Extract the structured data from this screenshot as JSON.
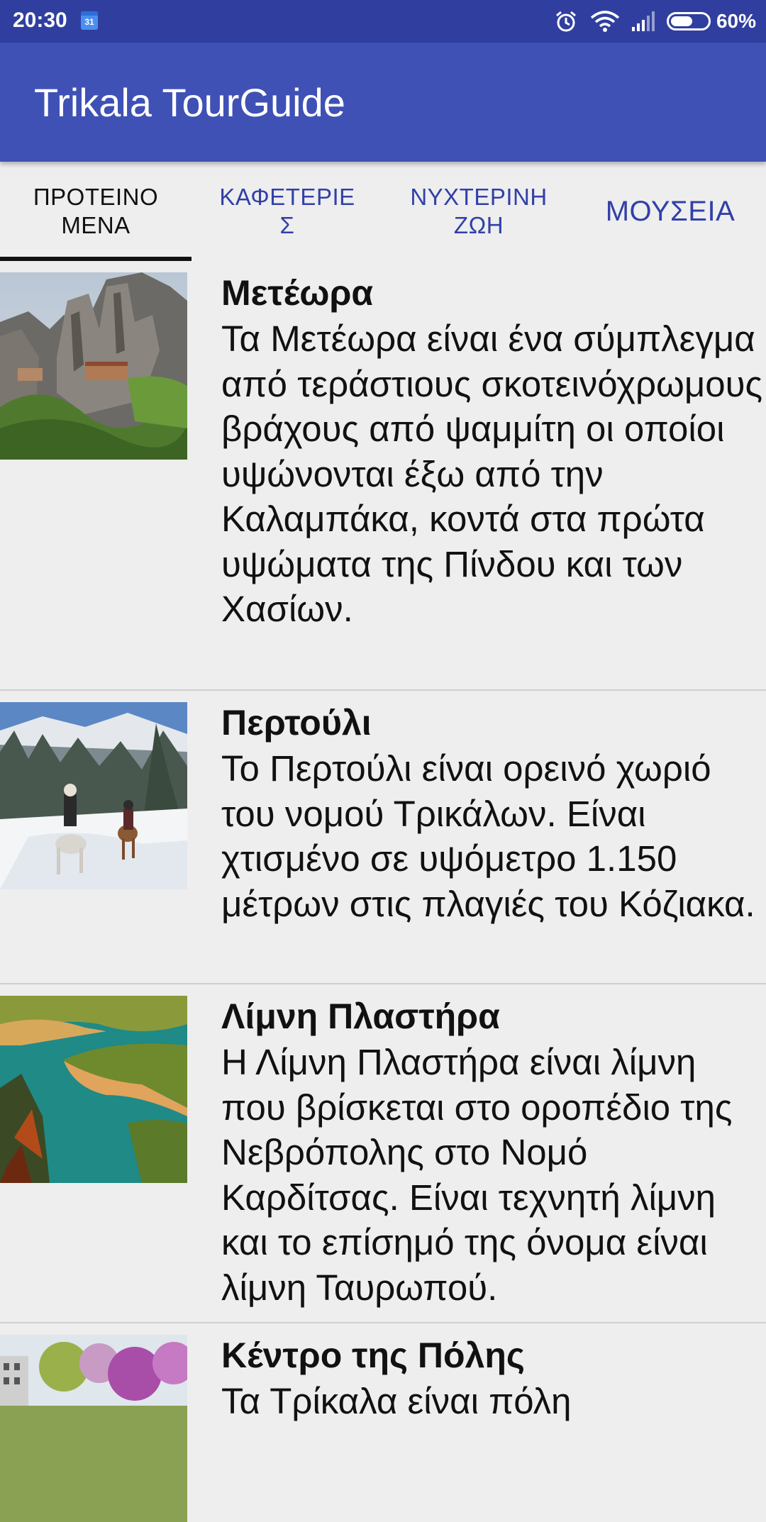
{
  "status_bar": {
    "time": "20:30",
    "calendar_day": "31",
    "battery_percent": "60%",
    "battery_level": 0.6,
    "icons": [
      "calendar-icon",
      "alarm-icon",
      "wifi-icon",
      "signal-icon",
      "battery-icon"
    ]
  },
  "app_bar": {
    "title": "Trikala TourGuide",
    "color": "#3f51b5"
  },
  "tabs": [
    {
      "label": "ΠΡΟΤΕΙΝΟ\nΜΕΝΑ",
      "active": true
    },
    {
      "label": "ΚΑΦΕΤΕΡΙΕ\nΣ",
      "active": false
    },
    {
      "label": "ΝΥΧΤΕΡΙΝΗ\nΖΩΗ",
      "active": false
    },
    {
      "label": "ΜΟΥΣΕΙΑ",
      "active": false
    }
  ],
  "items": [
    {
      "title": "Μετέωρα",
      "description": "Τα Μετέωρα είναι ένα σύμπλεγμα από τεράστιους σκοτεινόχρωμους βράχους από ψαμμίτη οι οποίοι υψώνονται έξω από την Καλαμπάκα, κοντά στα πρώτα υψώματα της Πίνδου και των Χασίων.",
      "image": "meteora-photo"
    },
    {
      "title": "Περτούλι",
      "description": "Το Περτούλι είναι ορεινό χωριό του νομού Τρικάλων. Είναι χτισμένο σε υψόμετρο 1.150 μέτρων στις πλαγιές του Κόζιακα.",
      "image": "pertouli-photo"
    },
    {
      "title": "Λίμνη Πλαστήρα",
      "description": "Η Λίμνη Πλαστήρα είναι λίμνη που βρίσκεται στο οροπέδιο της Νεβρόπολης στο Νομό Καρδίτσας. Είναι τεχνητή λίμνη και το επίσημό της όνομα είναι λίμνη Ταυρωπού.",
      "image": "lake-plastira-photo"
    },
    {
      "title": "Κέντρο της Πόλης",
      "description": "Τα Τρίκαλα είναι πόλη",
      "image": "city-center-photo"
    }
  ]
}
